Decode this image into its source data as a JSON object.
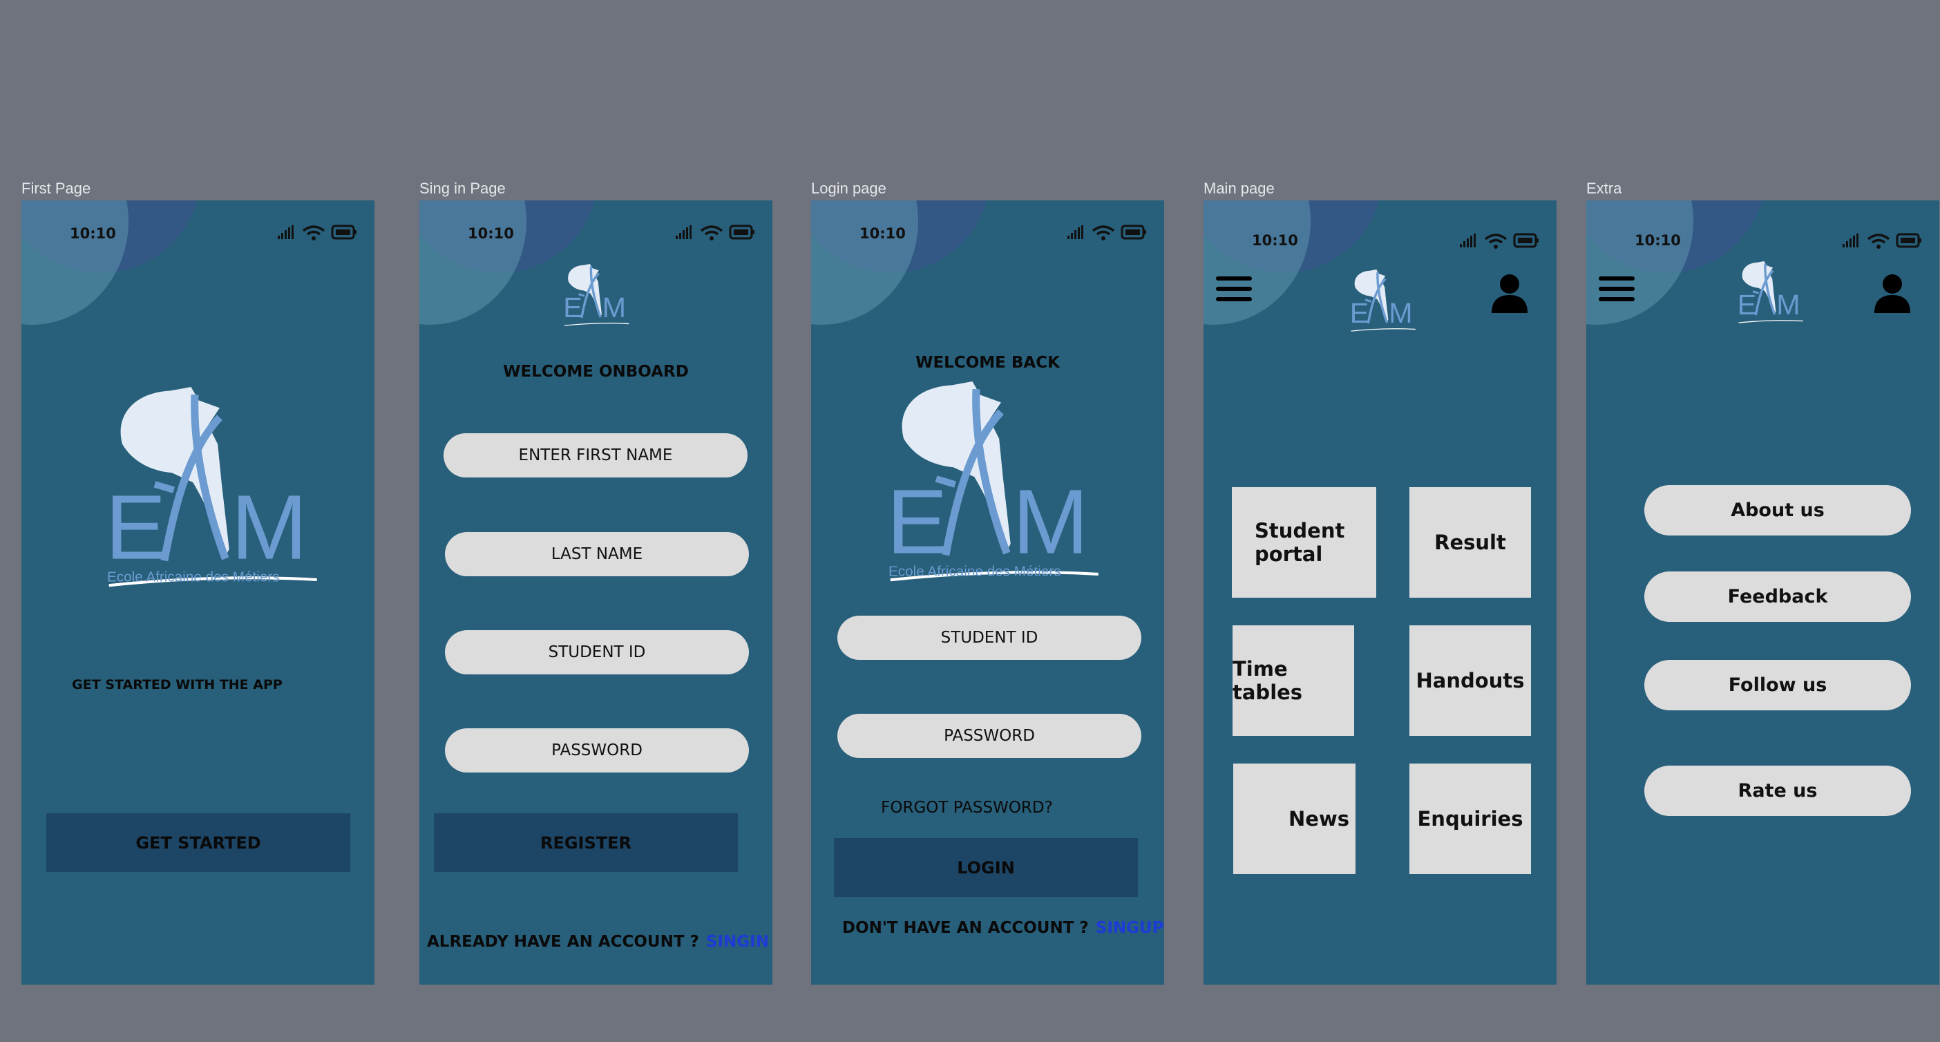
{
  "status_bar": {
    "time": "10:10"
  },
  "logo": {
    "caption": "Ecole Africaine des Métiers"
  },
  "frames": {
    "first": {
      "label": "First Page",
      "tagline": "GET STARTED WITH THE APP",
      "button": "GET STARTED"
    },
    "signin": {
      "label": "Sing in Page",
      "heading": "WELCOME ONBOARD",
      "fields": [
        "ENTER FIRST NAME",
        "LAST NAME",
        "STUDENT ID",
        "PASSWORD"
      ],
      "button": "REGISTER",
      "footer_text": "ALREADY HAVE AN ACCOUNT ?",
      "footer_link": "SINGIN"
    },
    "login": {
      "label": "Login page",
      "heading": "WELCOME BACK",
      "fields": [
        "STUDENT ID",
        "PASSWORD"
      ],
      "forgot": "FORGOT PASSWORD?",
      "button": "LOGIN",
      "footer_text": "DON'T HAVE AN ACCOUNT ?",
      "footer_link": "SINGUP"
    },
    "main": {
      "label": "Main page",
      "tiles": [
        "Student portal",
        "Result",
        "Time tables",
        "Handouts",
        "News",
        "Enquiries"
      ]
    },
    "extra": {
      "label": "Extra",
      "items": [
        "About us",
        "Feedback",
        "Follow us",
        "Rate us"
      ]
    }
  },
  "icons": [
    "signal-icon",
    "wifi-icon",
    "battery-icon",
    "menu-icon",
    "user-icon",
    "eam-logo"
  ],
  "colors": {
    "background": "#6f737d",
    "phone": "#285f7a",
    "button_dark": "#1d4566",
    "pill": "#dcdcdd",
    "link": "#1f3bd6"
  }
}
